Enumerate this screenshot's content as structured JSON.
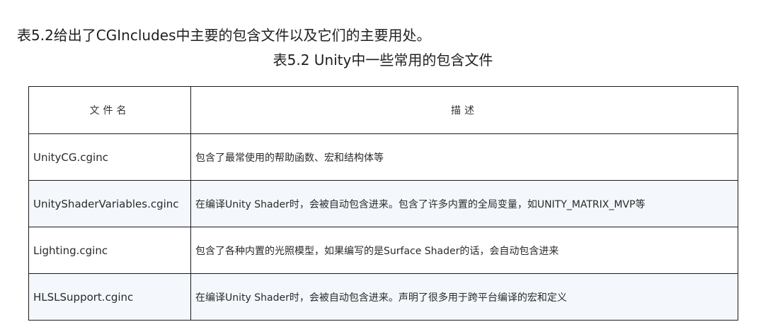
{
  "intro_text": "表5.2给出了CGIncludes中主要的包含文件以及它们的主要用处。",
  "table_caption": "表5.2 Unity中一些常用的包含文件",
  "table": {
    "headers": [
      "文件名",
      "描述"
    ],
    "rows": [
      {
        "file": "UnityCG.cginc",
        "description": "包含了最常使用的帮助函数、宏和结构体等"
      },
      {
        "file": "UnityShaderVariables.cginc",
        "description": "在编译Unity Shader时，会被自动包含进来。包含了许多内置的全局变量，如UNITY_MATRIX_MVP等"
      },
      {
        "file": "Lighting.cginc",
        "description": "包含了各种内置的光照模型，如果编写的是Surface Shader的话，会自动包含进来"
      },
      {
        "file": "HLSLSupport.cginc",
        "description": "在编译Unity Shader时，会被自动包含进来。声明了很多用于跨平台编译的宏和定义"
      }
    ]
  },
  "colors": {
    "alt_row_background": "#f4f8fd",
    "border": "#1a1a1a",
    "text": "#222222"
  }
}
